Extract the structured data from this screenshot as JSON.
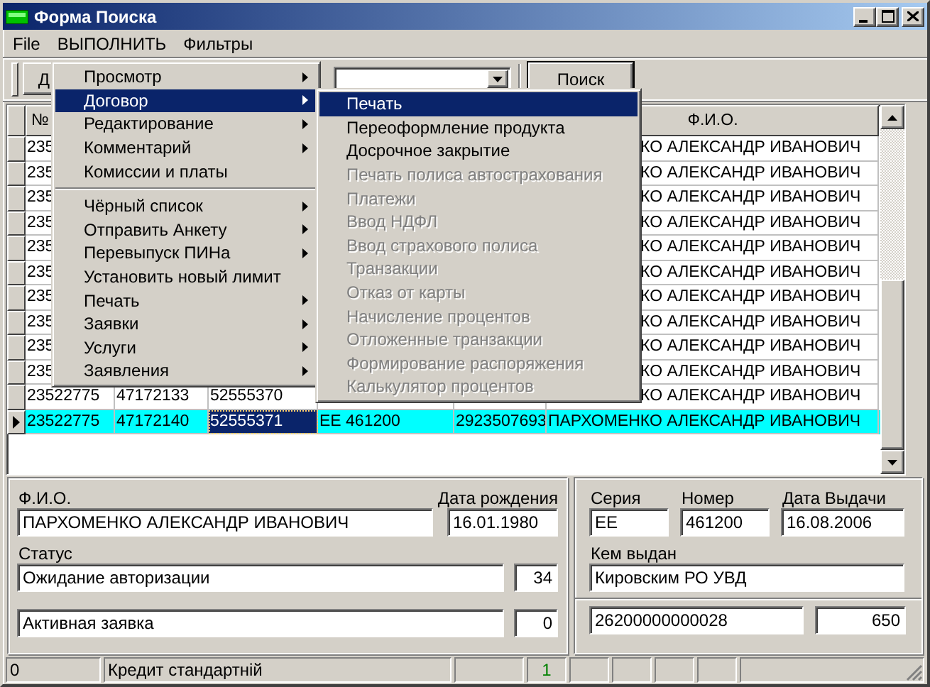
{
  "window": {
    "title": "Форма Поиска"
  },
  "menu_bar": [
    "File",
    "ВЫПОЛНИТЬ",
    "Фильтры"
  ],
  "toolbar": {
    "first_button": "Д",
    "search_button": "Поиск"
  },
  "grid": {
    "headers": {
      "column_1": "№",
      "fio": "Ф.И.О."
    },
    "rows": [
      {
        "kind": "partial",
        "selected": false,
        "cells": {
          "column_1": "235",
          "fio": "КО АЛЕКСАНДР ИВАНОВИЧ"
        }
      },
      {
        "kind": "partial",
        "selected": false,
        "cells": {
          "column_1": "235",
          "fio": "КО АЛЕКСАНДР ИВАНОВИЧ"
        }
      },
      {
        "kind": "partial",
        "selected": false,
        "cells": {
          "column_1": "235",
          "fio": "КО АЛЕКСАНДР ИВАНОВИЧ"
        }
      },
      {
        "kind": "partial",
        "selected": false,
        "cells": {
          "column_1": "235",
          "fio": "КО АЛЕКСАНДР ИВАНОВИЧ"
        }
      },
      {
        "kind": "partial",
        "selected": false,
        "cells": {
          "column_1": "235",
          "fio": "КО АЛЕКСАНДР ИВАНОВИЧ"
        }
      },
      {
        "kind": "partial",
        "selected": false,
        "cells": {
          "column_1": "235",
          "fio": "КО АЛЕКСАНДР ИВАНОВИЧ"
        }
      },
      {
        "kind": "partial",
        "selected": false,
        "cells": {
          "column_1": "235",
          "fio": "КО АЛЕКСАНДР ИВАНОВИЧ"
        }
      },
      {
        "kind": "partial",
        "selected": false,
        "cells": {
          "column_1": "235",
          "fio": "КО АЛЕКСАНДР ИВАНОВИЧ"
        }
      },
      {
        "kind": "partial",
        "selected": false,
        "cells": {
          "column_1": "235",
          "fio": "КО АЛЕКСАНДР ИВАНОВИЧ"
        }
      },
      {
        "kind": "partial",
        "selected": false,
        "cells": {
          "column_1": "235",
          "fio": "КО АЛЕКСАНДР ИВАНОВИЧ"
        }
      },
      {
        "kind": "partial",
        "selected": false,
        "cells": {
          "column_1": "23522775",
          "column_2": "47172133",
          "column_3": "52555370",
          "fio": "КО АЛЕКСАНДР ИВАНОВИЧ"
        }
      },
      {
        "kind": "full",
        "selected": true,
        "focused": true,
        "cells": {
          "column_1": "23522775",
          "column_2": "47172140",
          "column_3": "52555371",
          "column_4": "EE 461200",
          "column_5": "2923507693",
          "fio": "ПАРХОМЕНКО АЛЕКСАНДР ИВАНОВИЧ"
        }
      }
    ]
  },
  "menu": {
    "items": [
      {
        "kind": "item",
        "label": "Просмотр",
        "has_submenu": true,
        "selected": false
      },
      {
        "kind": "item",
        "label": "Договор",
        "has_submenu": true,
        "selected": true
      },
      {
        "kind": "item",
        "label": "Редактирование",
        "has_submenu": true,
        "selected": false
      },
      {
        "kind": "item",
        "label": "Комментарий",
        "has_submenu": true,
        "selected": false
      },
      {
        "kind": "item",
        "label": "Комиссии и платы",
        "has_submenu": false,
        "selected": false
      },
      {
        "kind": "separator"
      },
      {
        "kind": "item",
        "label": "Чёрный список",
        "has_submenu": true,
        "selected": false
      },
      {
        "kind": "item",
        "label": "Отправить Анкету",
        "has_submenu": true,
        "selected": false
      },
      {
        "kind": "item",
        "label": "Перевыпуск ПИНа",
        "has_submenu": true,
        "selected": false
      },
      {
        "kind": "item",
        "label": "Установить новый лимит",
        "has_submenu": false,
        "selected": false
      },
      {
        "kind": "item",
        "label": "Печать",
        "has_submenu": true,
        "selected": false
      },
      {
        "kind": "item",
        "label": "Заявки",
        "has_submenu": true,
        "selected": false
      },
      {
        "kind": "item",
        "label": "Услуги",
        "has_submenu": true,
        "selected": false
      },
      {
        "kind": "item",
        "label": "Заявления",
        "has_submenu": true,
        "selected": false
      }
    ]
  },
  "submenu": {
    "items": [
      {
        "label": "Печать",
        "selected": true,
        "disabled": false
      },
      {
        "label": "Переоформление продукта",
        "selected": false,
        "disabled": false
      },
      {
        "label": "Досрочное закрытие",
        "selected": false,
        "disabled": false
      },
      {
        "label": "Печать полиса автострахования",
        "selected": false,
        "disabled": true
      },
      {
        "label": "Платежи",
        "selected": false,
        "disabled": true
      },
      {
        "label": "Ввод НДФЛ",
        "selected": false,
        "disabled": true
      },
      {
        "label": "Ввод страхового полиса",
        "selected": false,
        "disabled": true
      },
      {
        "label": "Транзакции",
        "selected": false,
        "disabled": true
      },
      {
        "label": "Отказ от карты",
        "selected": false,
        "disabled": true
      },
      {
        "label": "Начисление процентов",
        "selected": false,
        "disabled": true
      },
      {
        "label": "Отложенные транзакции",
        "selected": false,
        "disabled": true
      },
      {
        "label": "Формирование распоряжения",
        "selected": false,
        "disabled": true
      },
      {
        "label": "Калькулятор процентов",
        "selected": false,
        "disabled": true
      }
    ]
  },
  "person": {
    "fio_label": "Ф.И.О.",
    "fio": "ПАРХОМЕНКО АЛЕКСАНДР ИВАНОВИЧ",
    "birth_label": "Дата рождения",
    "birth_date": "16.01.1980",
    "status_label": "Статус",
    "status": "Ожидание авторизации",
    "status_code": "34",
    "application": "Активная заявка",
    "application_count": "0"
  },
  "passport": {
    "series_label": "Серия",
    "series": "EE",
    "number_label": "Номер",
    "number": "461200",
    "issue_date_label": "Дата Выдачи",
    "issue_date": "16.08.2006",
    "issued_by_label": "Кем выдан",
    "issued_by": "Кировским РО УВД"
  },
  "account": {
    "number": "26200000000028",
    "field_2": "650"
  },
  "status_bar": {
    "panes": [
      "0",
      "Кредит стандартній"
    ],
    "indicator": "1"
  }
}
